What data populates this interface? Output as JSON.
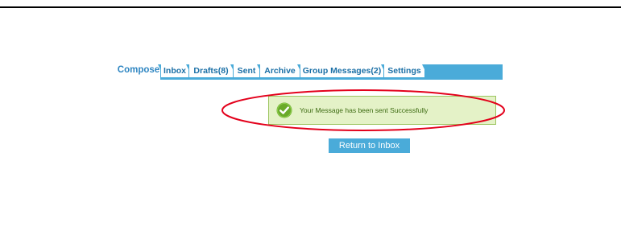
{
  "tabs": [
    {
      "label": "Compose",
      "active": true
    },
    {
      "label": "Inbox",
      "active": false
    },
    {
      "label": "Drafts(8)",
      "active": false
    },
    {
      "label": "Sent",
      "active": false
    },
    {
      "label": "Archive",
      "active": false
    },
    {
      "label": "Group Messages(2)",
      "active": false
    },
    {
      "label": "Settings",
      "active": false
    }
  ],
  "alert": {
    "message": "Your Message has been sent Successfully",
    "icon": "check-circle-icon",
    "status": "success"
  },
  "return_button": {
    "label": "Return to Inbox"
  },
  "colors": {
    "accent_blue": "#4aabd9",
    "success_bg": "#e4f2c7",
    "success_border": "#9cc45f",
    "success_icon": "#6aaa2a",
    "highlight_oval": "#e3001b"
  }
}
